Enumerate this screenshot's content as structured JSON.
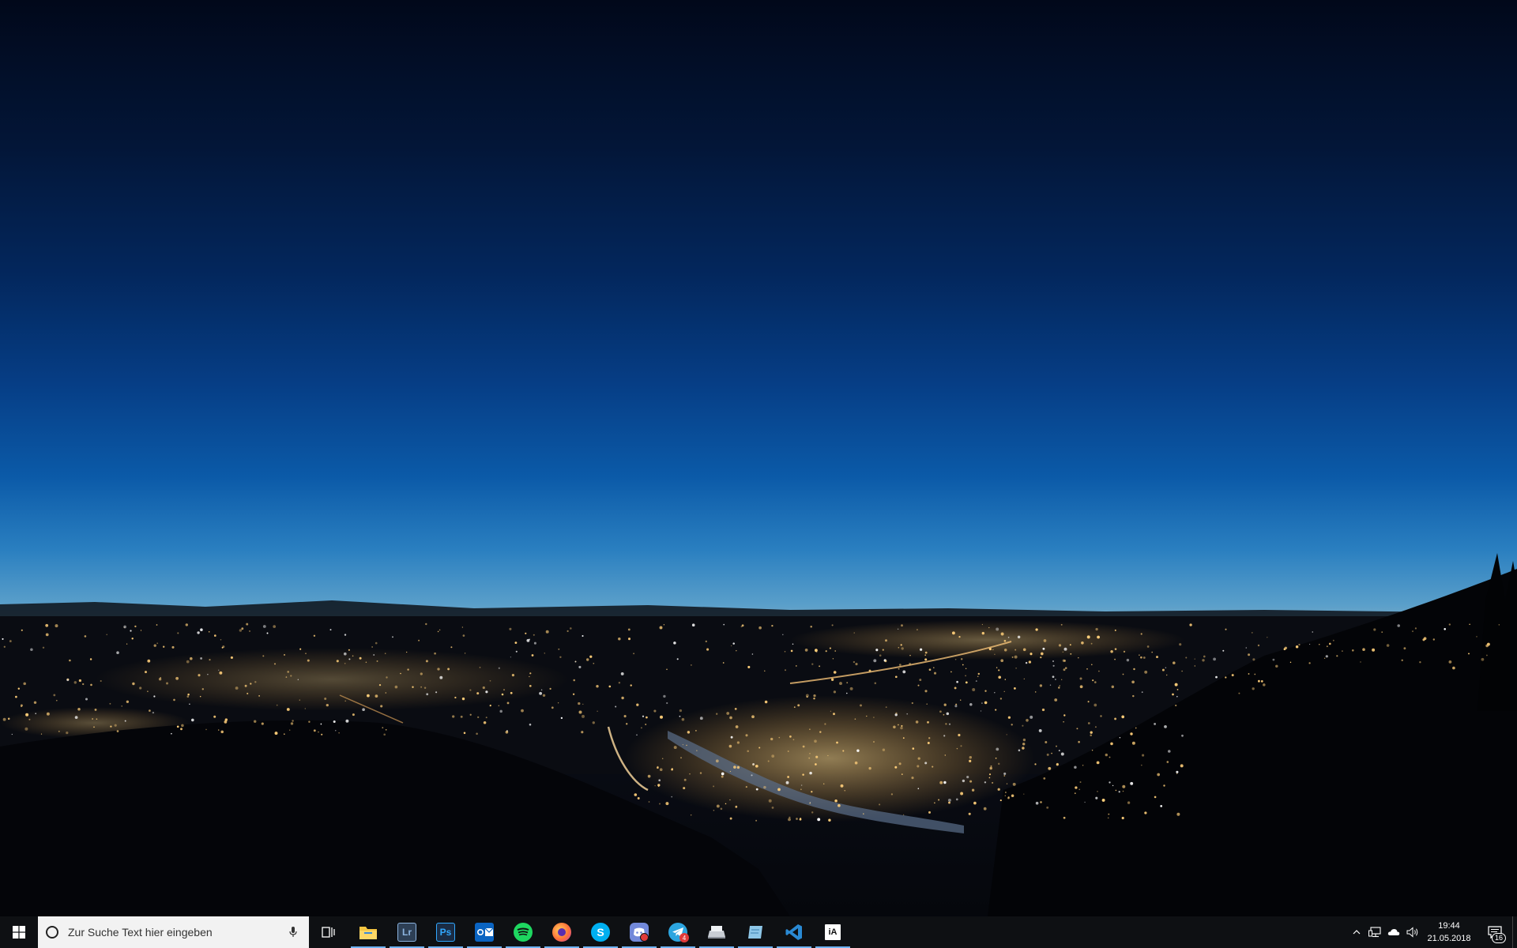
{
  "wallpaper": {
    "description_icon": "night-city-skyline-wallpaper",
    "colors": {
      "sky_top": "#01081a",
      "sky_mid": "#0b5aa8",
      "horizon": "#e8782f",
      "city_lights": "#ffcf7a"
    }
  },
  "taskbar": {
    "background": "#0e1013",
    "accent": "#6eb2f2",
    "search": {
      "placeholder": "Zur Suche Text hier eingeben",
      "icon": "cortana-icon",
      "mic_icon": "microphone-icon"
    },
    "task_view_icon": "task-view-icon",
    "apps": [
      {
        "id": "file-explorer",
        "icon": "folder-icon",
        "label": "",
        "color": "#f4c542",
        "running": true
      },
      {
        "id": "lightroom",
        "icon": "lightroom-icon",
        "label": "Lr",
        "color": "#2d3f55",
        "running": true
      },
      {
        "id": "photoshop",
        "icon": "photoshop-icon",
        "label": "Ps",
        "color": "#1a2c44",
        "running": true
      },
      {
        "id": "outlook",
        "icon": "outlook-icon",
        "label": "O",
        "color": "#0a64c2",
        "running": true
      },
      {
        "id": "spotify",
        "icon": "spotify-icon",
        "label": "",
        "color": "#1ed760",
        "running": true
      },
      {
        "id": "firefox",
        "icon": "firefox-icon",
        "label": "",
        "color": "#ff7139",
        "running": true
      },
      {
        "id": "skype",
        "icon": "skype-icon",
        "label": "S",
        "color": "#00aff0",
        "running": true
      },
      {
        "id": "discord",
        "icon": "discord-icon",
        "label": "",
        "color": "#7289da",
        "running": true
      },
      {
        "id": "telegram",
        "icon": "telegram-icon",
        "label": "",
        "color": "#2ca5e0",
        "running": true,
        "badge": "4"
      },
      {
        "id": "scanner",
        "icon": "scanner-icon",
        "label": "",
        "color": "#c8cdd4",
        "running": true
      },
      {
        "id": "notepad",
        "icon": "notepad-icon",
        "label": "",
        "color": "#8ec7e8",
        "running": true
      },
      {
        "id": "vscode",
        "icon": "vscode-icon",
        "label": "",
        "color": "#2a8ad4",
        "running": true
      },
      {
        "id": "ia-writer",
        "icon": "ia-writer-icon",
        "label": "iA",
        "color": "#ffffff",
        "running": true
      }
    ],
    "tray": {
      "chevron_icon": "chevron-up-icon",
      "network_icon": "network-icon",
      "onedrive_icon": "cloud-icon",
      "volume_icon": "speaker-icon"
    },
    "clock": {
      "time": "19:44",
      "date": "21.05.2018"
    },
    "notifications": {
      "icon": "action-center-icon",
      "count": "16"
    }
  }
}
